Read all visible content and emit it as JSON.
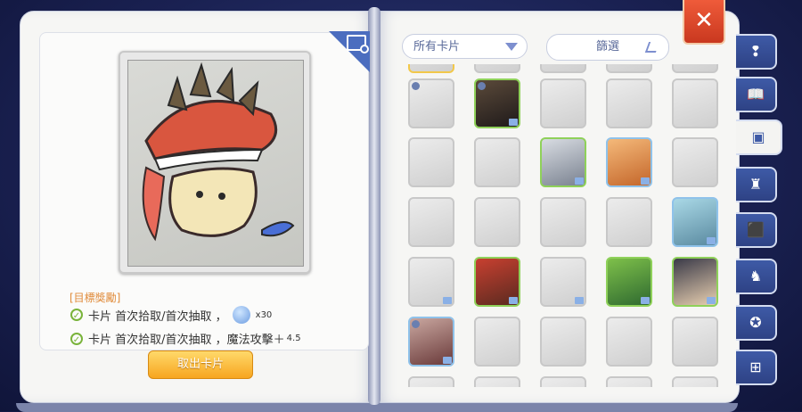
{
  "header": {
    "close_label": "✕"
  },
  "detail": {
    "zoom_icon": "zoom-card-icon",
    "reward_title": "[目標獎勵]",
    "rewards": [
      {
        "text": "卡片 首次拾取/首次抽取 ，",
        "value": "x30",
        "icon": "zeny-coin-icon"
      },
      {
        "text": "卡片 首次拾取/首次抽取 ，魔法攻擊＋",
        "value": "4.5"
      }
    ],
    "take_out_label": "取出卡片"
  },
  "filters": {
    "dropdown_value": "所有卡片",
    "filter_label": "篩選"
  },
  "side_tabs": [
    "hint-icon",
    "book-icon",
    "card-icon",
    "chair-icon",
    "toolbox-icon",
    "rocking-horse-icon",
    "medal-icon",
    "hierarchy-icon"
  ],
  "colors": {
    "accent": "#3e5aa6",
    "close": "#e04a2c",
    "button": "#f7a51f",
    "collected_border": "#8fd15a"
  }
}
